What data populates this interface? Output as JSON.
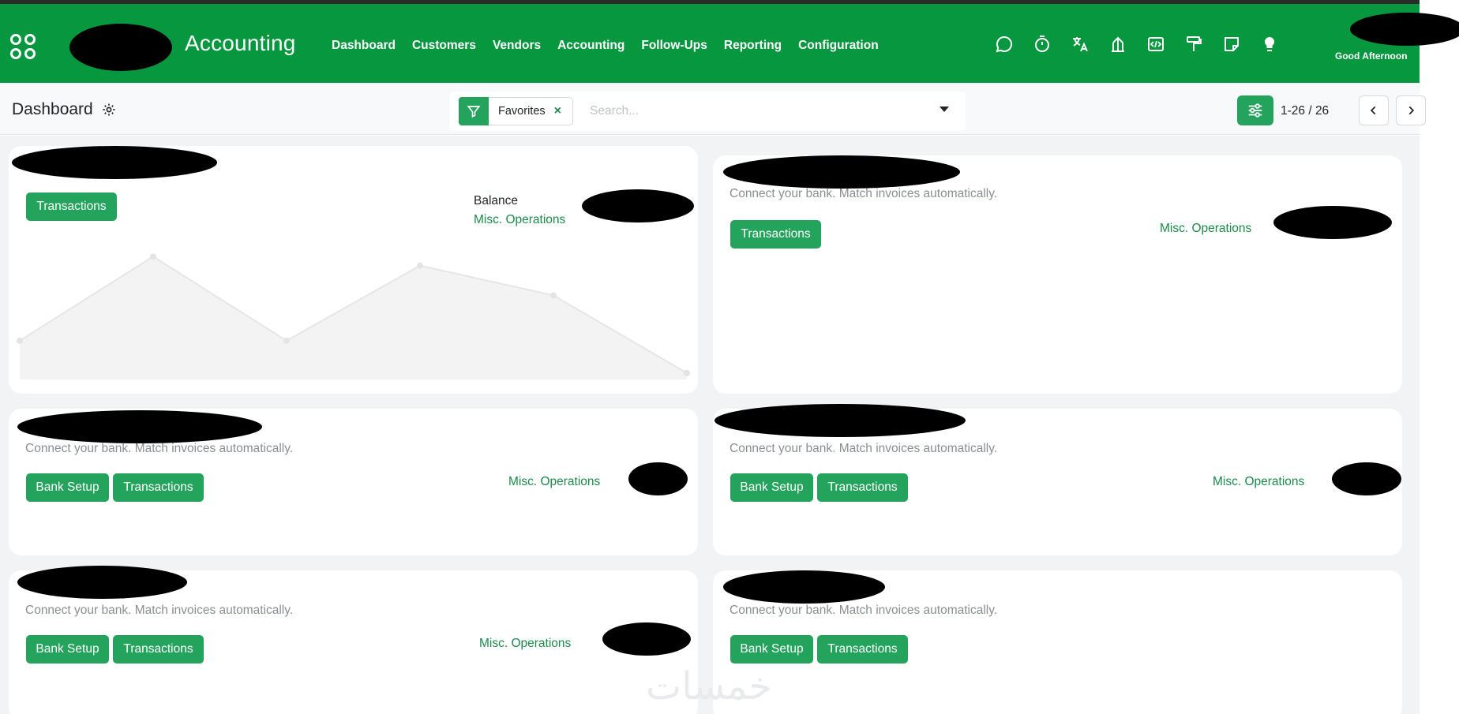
{
  "app": {
    "title": "Accounting"
  },
  "nav": {
    "menu": [
      "Dashboard",
      "Customers",
      "Vendors",
      "Accounting",
      "Follow-Ups",
      "Reporting",
      "Configuration"
    ],
    "systray_icons": [
      "chat-icon",
      "stopwatch-icon",
      "translate-icon",
      "bank-icon",
      "code-icon",
      "paint-roller-icon",
      "note-icon",
      "lightbulb-icon"
    ],
    "greeting": "Good Afternoon"
  },
  "control": {
    "title": "Dashboard",
    "facet_label": "Favorites",
    "facet_remove": "×",
    "search_placeholder": "Search...",
    "pager": "1-26 / 26"
  },
  "colors": {
    "brand": "#06973f",
    "accent": "#23a35b",
    "link": "#1c8a4b"
  },
  "cards": [
    {
      "balance_label": "Balance",
      "misc": "Misc. Operations",
      "buttons": [
        "Transactions"
      ],
      "graph": [
        0.3,
        0.95,
        0.3,
        0.88,
        0.65,
        0.05
      ]
    },
    {
      "subtitle": "Connect your bank. Match invoices automatically.",
      "misc": "Misc. Operations",
      "buttons": [
        "Transactions"
      ]
    },
    {
      "subtitle": "Connect your bank. Match invoices automatically.",
      "misc": "Misc. Operations",
      "buttons": [
        "Bank Setup",
        "Transactions"
      ]
    },
    {
      "subtitle": "Connect your bank. Match invoices automatically.",
      "misc": "Misc. Operations",
      "buttons": [
        "Bank Setup",
        "Transactions"
      ]
    },
    {
      "subtitle": "Connect your bank. Match invoices automatically.",
      "misc": "Misc. Operations",
      "buttons": [
        "Bank Setup",
        "Transactions"
      ]
    },
    {
      "subtitle": "Connect your bank. Match invoices automatically.",
      "misc": "Misc. Operations",
      "buttons": [
        "Bank Setup",
        "Transactions"
      ]
    }
  ],
  "watermark": "خمسات"
}
